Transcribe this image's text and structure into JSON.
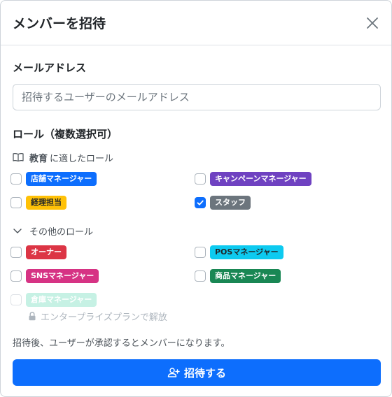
{
  "dialog": {
    "title": "メンバーを招待",
    "close_icon": "close-icon"
  },
  "email": {
    "label": "メールアドレス",
    "placeholder": "招待するユーザーのメールアドレス",
    "value": ""
  },
  "roles": {
    "label": "ロール（複数選択可）",
    "education_group": {
      "icon": "book-icon",
      "name": "教育",
      "suffix": "に適したロール",
      "items": [
        {
          "label": "店舗マネージャー",
          "color": "#0d6efd",
          "checked": false
        },
        {
          "label": "キャンペーンマネージャー",
          "color": "#6f42c1",
          "checked": false
        },
        {
          "label": "経理担当",
          "color": "#ffc107",
          "text_color": "#212529",
          "checked": false
        },
        {
          "label": "スタッフ",
          "color": "#6c757d",
          "checked": true
        }
      ]
    },
    "other_group": {
      "icon": "chevron-down-icon",
      "label": "その他のロール",
      "items": [
        {
          "label": "オーナー",
          "color": "#dc3545",
          "checked": false
        },
        {
          "label": "POSマネージャー",
          "color": "#0dcaf0",
          "checked": false
        },
        {
          "label": "SNSマネージャー",
          "color": "#d63384",
          "checked": false
        },
        {
          "label": "商品マネージャー",
          "color": "#198754",
          "checked": false
        }
      ],
      "disabled_item": {
        "label": "倉庫マネージャー",
        "color": "#20c997",
        "checked": false
      },
      "lock_icon": "lock-icon",
      "lock_text": "エンタープライズプランで解放"
    }
  },
  "note": "招待後、ユーザーが承認するとメンバーになります。",
  "invite_button": {
    "icon": "person-plus-icon",
    "label": "招待する"
  }
}
